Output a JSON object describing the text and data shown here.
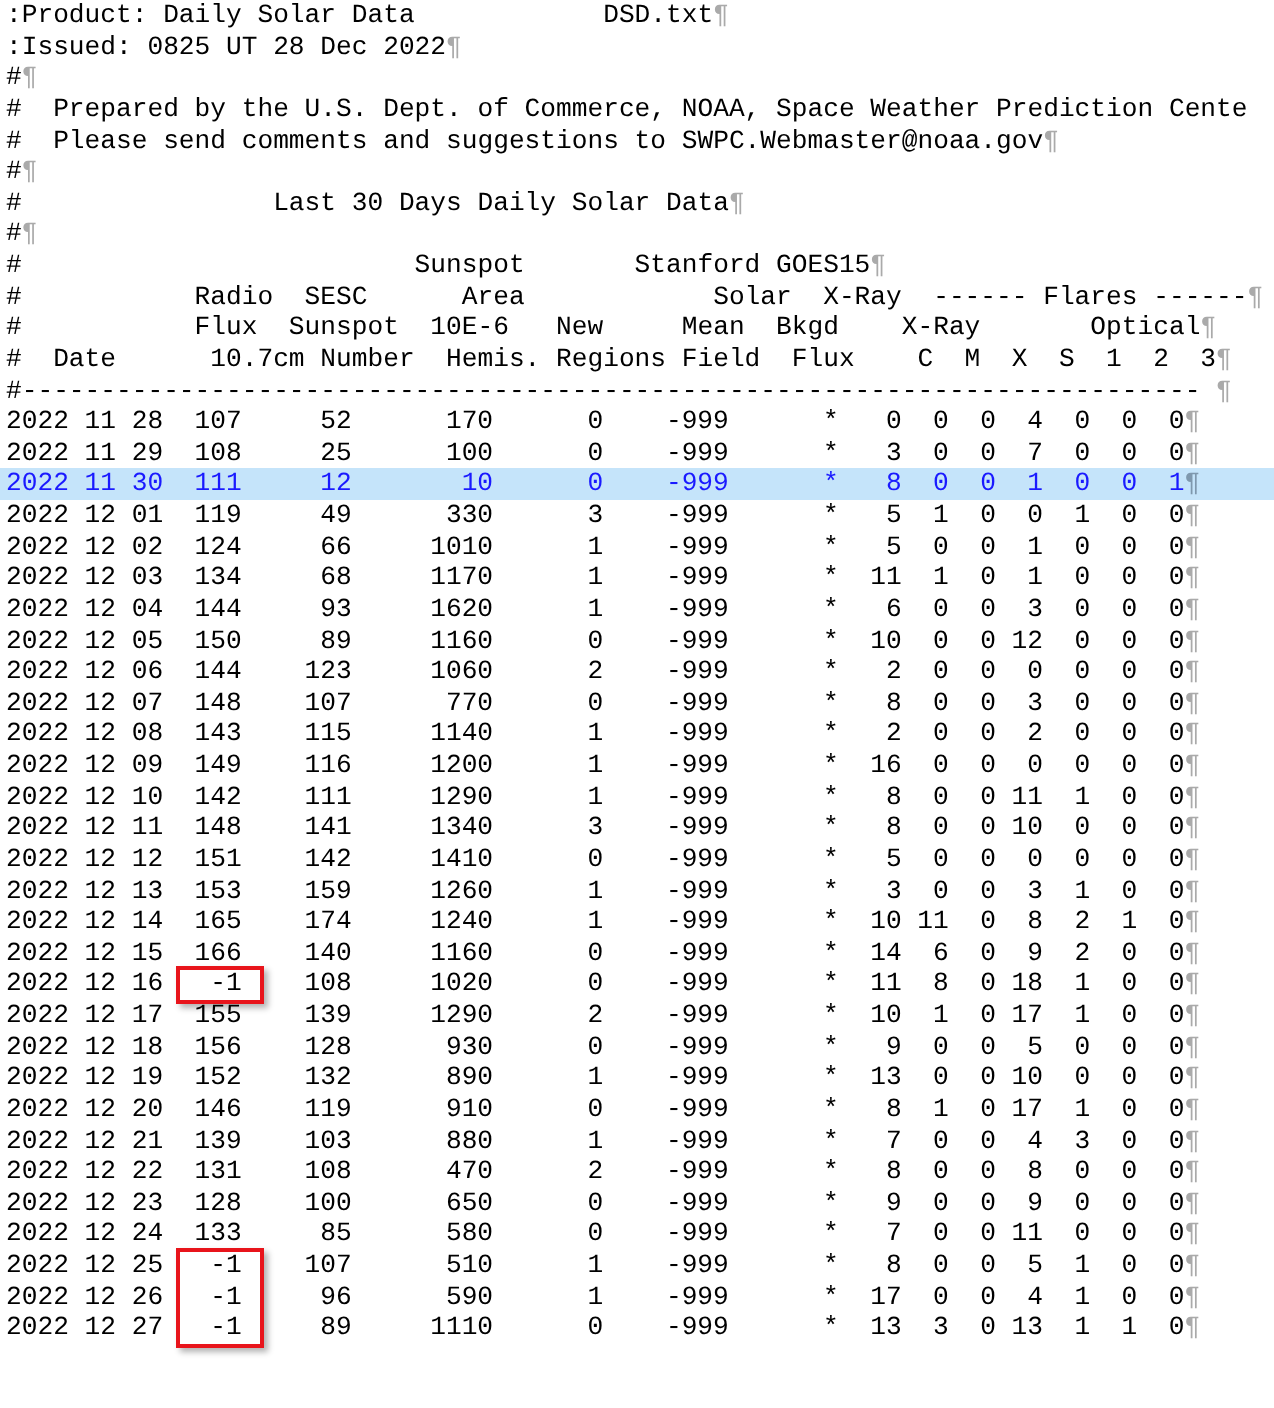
{
  "eol_mark": "¶",
  "header_lines": [
    {
      "text": ":Product: Daily Solar Data            DSD.txt",
      "eol": true
    },
    {
      "text": ":Issued: 0825 UT 28 Dec 2022",
      "eol": true
    },
    {
      "text": "#",
      "eol": true
    },
    {
      "text": "#  Prepared by the U.S. Dept. of Commerce, NOAA, Space Weather Prediction Cente",
      "eol": false
    },
    {
      "text": "#  Please send comments and suggestions to SWPC.Webmaster@noaa.gov",
      "eol": true
    },
    {
      "text": "#",
      "eol": true
    },
    {
      "text": "#                Last 30 Days Daily Solar Data",
      "eol": true
    },
    {
      "text": "#",
      "eol": true
    },
    {
      "text": "#                         Sunspot       Stanford GOES15",
      "eol": true
    },
    {
      "text": "#           Radio  SESC      Area            Solar  X-Ray  ------ Flares ------",
      "eol": true
    },
    {
      "text": "#           Flux  Sunspot  10E-6   New     Mean  Bkgd    X-Ray       Optical",
      "eol": true
    },
    {
      "text": "#  Date      10.7cm Number  Hemis. Regions Field  Flux    C  M  X  S  1  2  3",
      "eol": true
    },
    {
      "text": "#--------------------------------------------------------------------------- ",
      "eol": true
    }
  ],
  "rows": [
    {
      "values": [
        "2022 11 28",
        "107",
        "52",
        "170",
        "0",
        "-999",
        "*",
        "0",
        "0",
        "0",
        "4",
        "0",
        "0",
        "0"
      ],
      "selected": false,
      "flux_boxed": false
    },
    {
      "values": [
        "2022 11 29",
        "108",
        "25",
        "100",
        "0",
        "-999",
        "*",
        "3",
        "0",
        "0",
        "7",
        "0",
        "0",
        "0"
      ],
      "selected": false,
      "flux_boxed": false
    },
    {
      "values": [
        "2022 11 30",
        "111",
        "12",
        "10",
        "0",
        "-999",
        "*",
        "8",
        "0",
        "0",
        "1",
        "0",
        "0",
        "1"
      ],
      "selected": true,
      "flux_boxed": false
    },
    {
      "values": [
        "2022 12 01",
        "119",
        "49",
        "330",
        "3",
        "-999",
        "*",
        "5",
        "1",
        "0",
        "0",
        "1",
        "0",
        "0"
      ],
      "selected": false,
      "flux_boxed": false
    },
    {
      "values": [
        "2022 12 02",
        "124",
        "66",
        "1010",
        "1",
        "-999",
        "*",
        "5",
        "0",
        "0",
        "1",
        "0",
        "0",
        "0"
      ],
      "selected": false,
      "flux_boxed": false
    },
    {
      "values": [
        "2022 12 03",
        "134",
        "68",
        "1170",
        "1",
        "-999",
        "*",
        "11",
        "1",
        "0",
        "1",
        "0",
        "0",
        "0"
      ],
      "selected": false,
      "flux_boxed": false
    },
    {
      "values": [
        "2022 12 04",
        "144",
        "93",
        "1620",
        "1",
        "-999",
        "*",
        "6",
        "0",
        "0",
        "3",
        "0",
        "0",
        "0"
      ],
      "selected": false,
      "flux_boxed": false
    },
    {
      "values": [
        "2022 12 05",
        "150",
        "89",
        "1160",
        "0",
        "-999",
        "*",
        "10",
        "0",
        "0",
        "12",
        "0",
        "0",
        "0"
      ],
      "selected": false,
      "flux_boxed": false
    },
    {
      "values": [
        "2022 12 06",
        "144",
        "123",
        "1060",
        "2",
        "-999",
        "*",
        "2",
        "0",
        "0",
        "0",
        "0",
        "0",
        "0"
      ],
      "selected": false,
      "flux_boxed": false
    },
    {
      "values": [
        "2022 12 07",
        "148",
        "107",
        "770",
        "0",
        "-999",
        "*",
        "8",
        "0",
        "0",
        "3",
        "0",
        "0",
        "0"
      ],
      "selected": false,
      "flux_boxed": false
    },
    {
      "values": [
        "2022 12 08",
        "143",
        "115",
        "1140",
        "1",
        "-999",
        "*",
        "2",
        "0",
        "0",
        "2",
        "0",
        "0",
        "0"
      ],
      "selected": false,
      "flux_boxed": false
    },
    {
      "values": [
        "2022 12 09",
        "149",
        "116",
        "1200",
        "1",
        "-999",
        "*",
        "16",
        "0",
        "0",
        "0",
        "0",
        "0",
        "0"
      ],
      "selected": false,
      "flux_boxed": false
    },
    {
      "values": [
        "2022 12 10",
        "142",
        "111",
        "1290",
        "1",
        "-999",
        "*",
        "8",
        "0",
        "0",
        "11",
        "1",
        "0",
        "0"
      ],
      "selected": false,
      "flux_boxed": false
    },
    {
      "values": [
        "2022 12 11",
        "148",
        "141",
        "1340",
        "3",
        "-999",
        "*",
        "8",
        "0",
        "0",
        "10",
        "0",
        "0",
        "0"
      ],
      "selected": false,
      "flux_boxed": false
    },
    {
      "values": [
        "2022 12 12",
        "151",
        "142",
        "1410",
        "0",
        "-999",
        "*",
        "5",
        "0",
        "0",
        "0",
        "0",
        "0",
        "0"
      ],
      "selected": false,
      "flux_boxed": false
    },
    {
      "values": [
        "2022 12 13",
        "153",
        "159",
        "1260",
        "1",
        "-999",
        "*",
        "3",
        "0",
        "0",
        "3",
        "1",
        "0",
        "0"
      ],
      "selected": false,
      "flux_boxed": false
    },
    {
      "values": [
        "2022 12 14",
        "165",
        "174",
        "1240",
        "1",
        "-999",
        "*",
        "10",
        "11",
        "0",
        "8",
        "2",
        "1",
        "0"
      ],
      "selected": false,
      "flux_boxed": false
    },
    {
      "values": [
        "2022 12 15",
        "166",
        "140",
        "1160",
        "0",
        "-999",
        "*",
        "14",
        "6",
        "0",
        "9",
        "2",
        "0",
        "0"
      ],
      "selected": false,
      "flux_boxed": false
    },
    {
      "values": [
        "2022 12 16",
        "-1",
        "108",
        "1020",
        "0",
        "-999",
        "*",
        "11",
        "8",
        "0",
        "18",
        "1",
        "0",
        "0"
      ],
      "selected": false,
      "flux_boxed": true
    },
    {
      "values": [
        "2022 12 17",
        "155",
        "139",
        "1290",
        "2",
        "-999",
        "*",
        "10",
        "1",
        "0",
        "17",
        "1",
        "0",
        "0"
      ],
      "selected": false,
      "flux_boxed": false
    },
    {
      "values": [
        "2022 12 18",
        "156",
        "128",
        "930",
        "0",
        "-999",
        "*",
        "9",
        "0",
        "0",
        "5",
        "0",
        "0",
        "0"
      ],
      "selected": false,
      "flux_boxed": false
    },
    {
      "values": [
        "2022 12 19",
        "152",
        "132",
        "890",
        "1",
        "-999",
        "*",
        "13",
        "0",
        "0",
        "10",
        "0",
        "0",
        "0"
      ],
      "selected": false,
      "flux_boxed": false
    },
    {
      "values": [
        "2022 12 20",
        "146",
        "119",
        "910",
        "0",
        "-999",
        "*",
        "8",
        "1",
        "0",
        "17",
        "1",
        "0",
        "0"
      ],
      "selected": false,
      "flux_boxed": false
    },
    {
      "values": [
        "2022 12 21",
        "139",
        "103",
        "880",
        "1",
        "-999",
        "*",
        "7",
        "0",
        "0",
        "4",
        "3",
        "0",
        "0"
      ],
      "selected": false,
      "flux_boxed": false
    },
    {
      "values": [
        "2022 12 22",
        "131",
        "108",
        "470",
        "2",
        "-999",
        "*",
        "8",
        "0",
        "0",
        "8",
        "0",
        "0",
        "0"
      ],
      "selected": false,
      "flux_boxed": false
    },
    {
      "values": [
        "2022 12 23",
        "128",
        "100",
        "650",
        "0",
        "-999",
        "*",
        "9",
        "0",
        "0",
        "9",
        "0",
        "0",
        "0"
      ],
      "selected": false,
      "flux_boxed": false
    },
    {
      "values": [
        "2022 12 24",
        "133",
        "85",
        "580",
        "0",
        "-999",
        "*",
        "7",
        "0",
        "0",
        "11",
        "0",
        "0",
        "0"
      ],
      "selected": false,
      "flux_boxed": false
    },
    {
      "values": [
        "2022 12 25",
        "-1",
        "107",
        "510",
        "1",
        "-999",
        "*",
        "8",
        "0",
        "0",
        "5",
        "1",
        "0",
        "0"
      ],
      "selected": false,
      "flux_boxed": true
    },
    {
      "values": [
        "2022 12 26",
        "-1",
        "96",
        "590",
        "1",
        "-999",
        "*",
        "17",
        "0",
        "0",
        "4",
        "1",
        "0",
        "0"
      ],
      "selected": false,
      "flux_boxed": true
    },
    {
      "values": [
        "2022 12 27",
        "-1",
        "89",
        "1110",
        "0",
        "-999",
        "*",
        "13",
        "3",
        "0",
        "13",
        "1",
        "1",
        "0"
      ],
      "selected": false,
      "flux_boxed": true
    }
  ]
}
